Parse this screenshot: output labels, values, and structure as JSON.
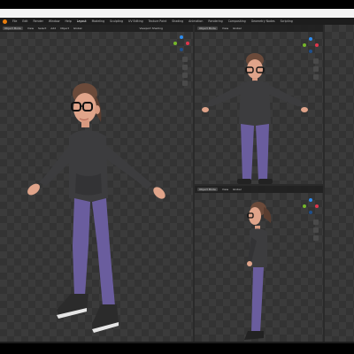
{
  "app": {
    "menu": [
      "File",
      "Edit",
      "Render",
      "Window",
      "Help"
    ],
    "workspaces": [
      "Layout",
      "Modeling",
      "Sculpting",
      "UV Editing",
      "Texture Paint",
      "Shading",
      "Animation",
      "Rendering",
      "Compositing",
      "Geometry Nodes",
      "Scripting"
    ],
    "active_workspace": "Layout"
  },
  "viewports": {
    "main": {
      "mode": "Object Mode",
      "view": "View",
      "select": "Select",
      "add": "Add",
      "object": "Object",
      "transform": "Global",
      "overlay": "Viewport Shading"
    },
    "front": {
      "mode": "Object Mode",
      "view": "View",
      "transform": "Global"
    },
    "side": {
      "mode": "Object Mode",
      "view": "View",
      "transform": "Global"
    }
  },
  "colors": {
    "accent": "#e87d0d",
    "axis_x": "#e2364b",
    "axis_y": "#76b82a",
    "axis_z": "#2d8cf0",
    "sweater": "#3c3c3e",
    "pants": "#6a5d9e",
    "skin": "#e0a48a",
    "hair": "#6b4a3a",
    "shoes": "#2b2b2b"
  },
  "icons": [
    "blender-logo-icon",
    "navigation-gizmo-icon",
    "zoom-icon",
    "pan-icon",
    "camera-icon",
    "grid-icon"
  ]
}
